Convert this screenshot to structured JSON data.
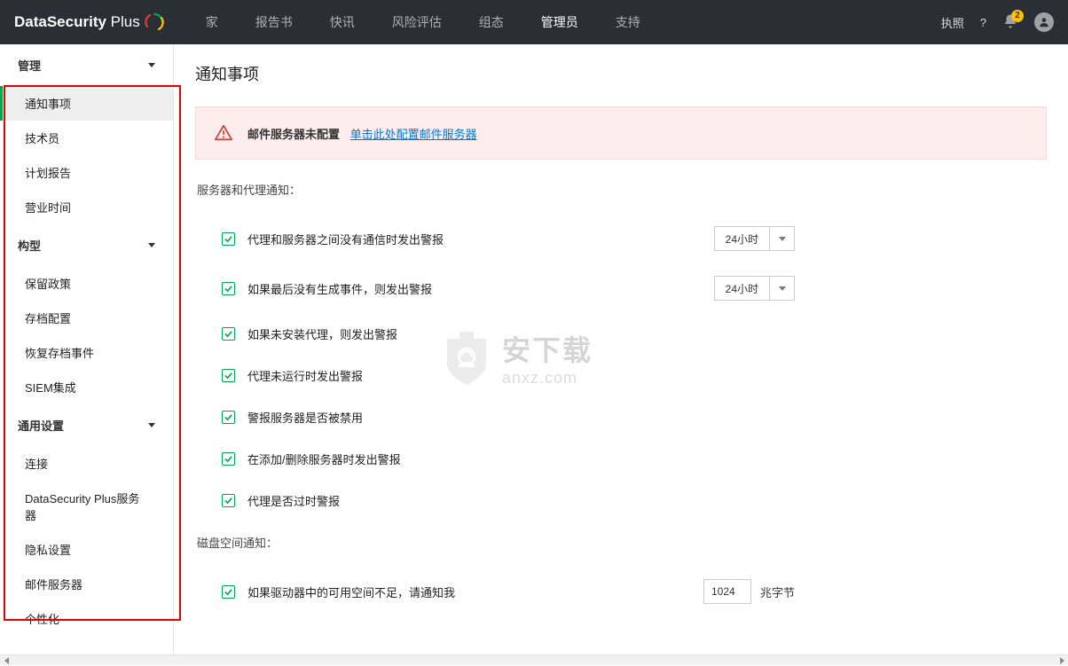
{
  "header": {
    "logo_main": "DataSecurity",
    "logo_sub": "Plus",
    "nav": [
      "家",
      "报告书",
      "快讯",
      "风险评估",
      "组态",
      "管理员",
      "支持"
    ],
    "active_nav_index": 5,
    "license": "执照",
    "help": "?",
    "badge_count": "2"
  },
  "sidebar": {
    "groups": [
      {
        "title": "管理",
        "items": [
          "通知事项",
          "技术员",
          "计划报告",
          "营业时间"
        ],
        "active_index": 0
      },
      {
        "title": "构型",
        "items": [
          "保留政策",
          "存档配置",
          "恢复存档事件",
          "SIEM集成"
        ]
      },
      {
        "title": "通用设置",
        "items": [
          "连接",
          "DataSecurity Plus服务器",
          "隐私设置",
          "邮件服务器",
          "个性化"
        ]
      }
    ]
  },
  "page": {
    "title": "通知事项",
    "alert_bold": "邮件服务器未配置",
    "alert_link": "单击此处配置邮件服务器",
    "section1_title": "服务器和代理通知：",
    "options": [
      {
        "label": "代理和服务器之间没有通信时发出警报",
        "select": "24小时"
      },
      {
        "label": "如果最后没有生成事件，则发出警报",
        "select": "24小时"
      },
      {
        "label": "如果未安装代理，则发出警报"
      },
      {
        "label": "代理未运行时发出警报"
      },
      {
        "label": "警报服务器是否被禁用"
      },
      {
        "label": "在添加/删除服务器时发出警报"
      },
      {
        "label": "代理是否过时警报"
      }
    ],
    "section2_title": "磁盘空间通知：",
    "disk_opt_label": "如果驱动器中的可用空间不足，请通知我",
    "disk_input": "1024",
    "disk_unit": "兆字节"
  },
  "watermark": {
    "cn": "安下载",
    "en": "anxz.com"
  }
}
